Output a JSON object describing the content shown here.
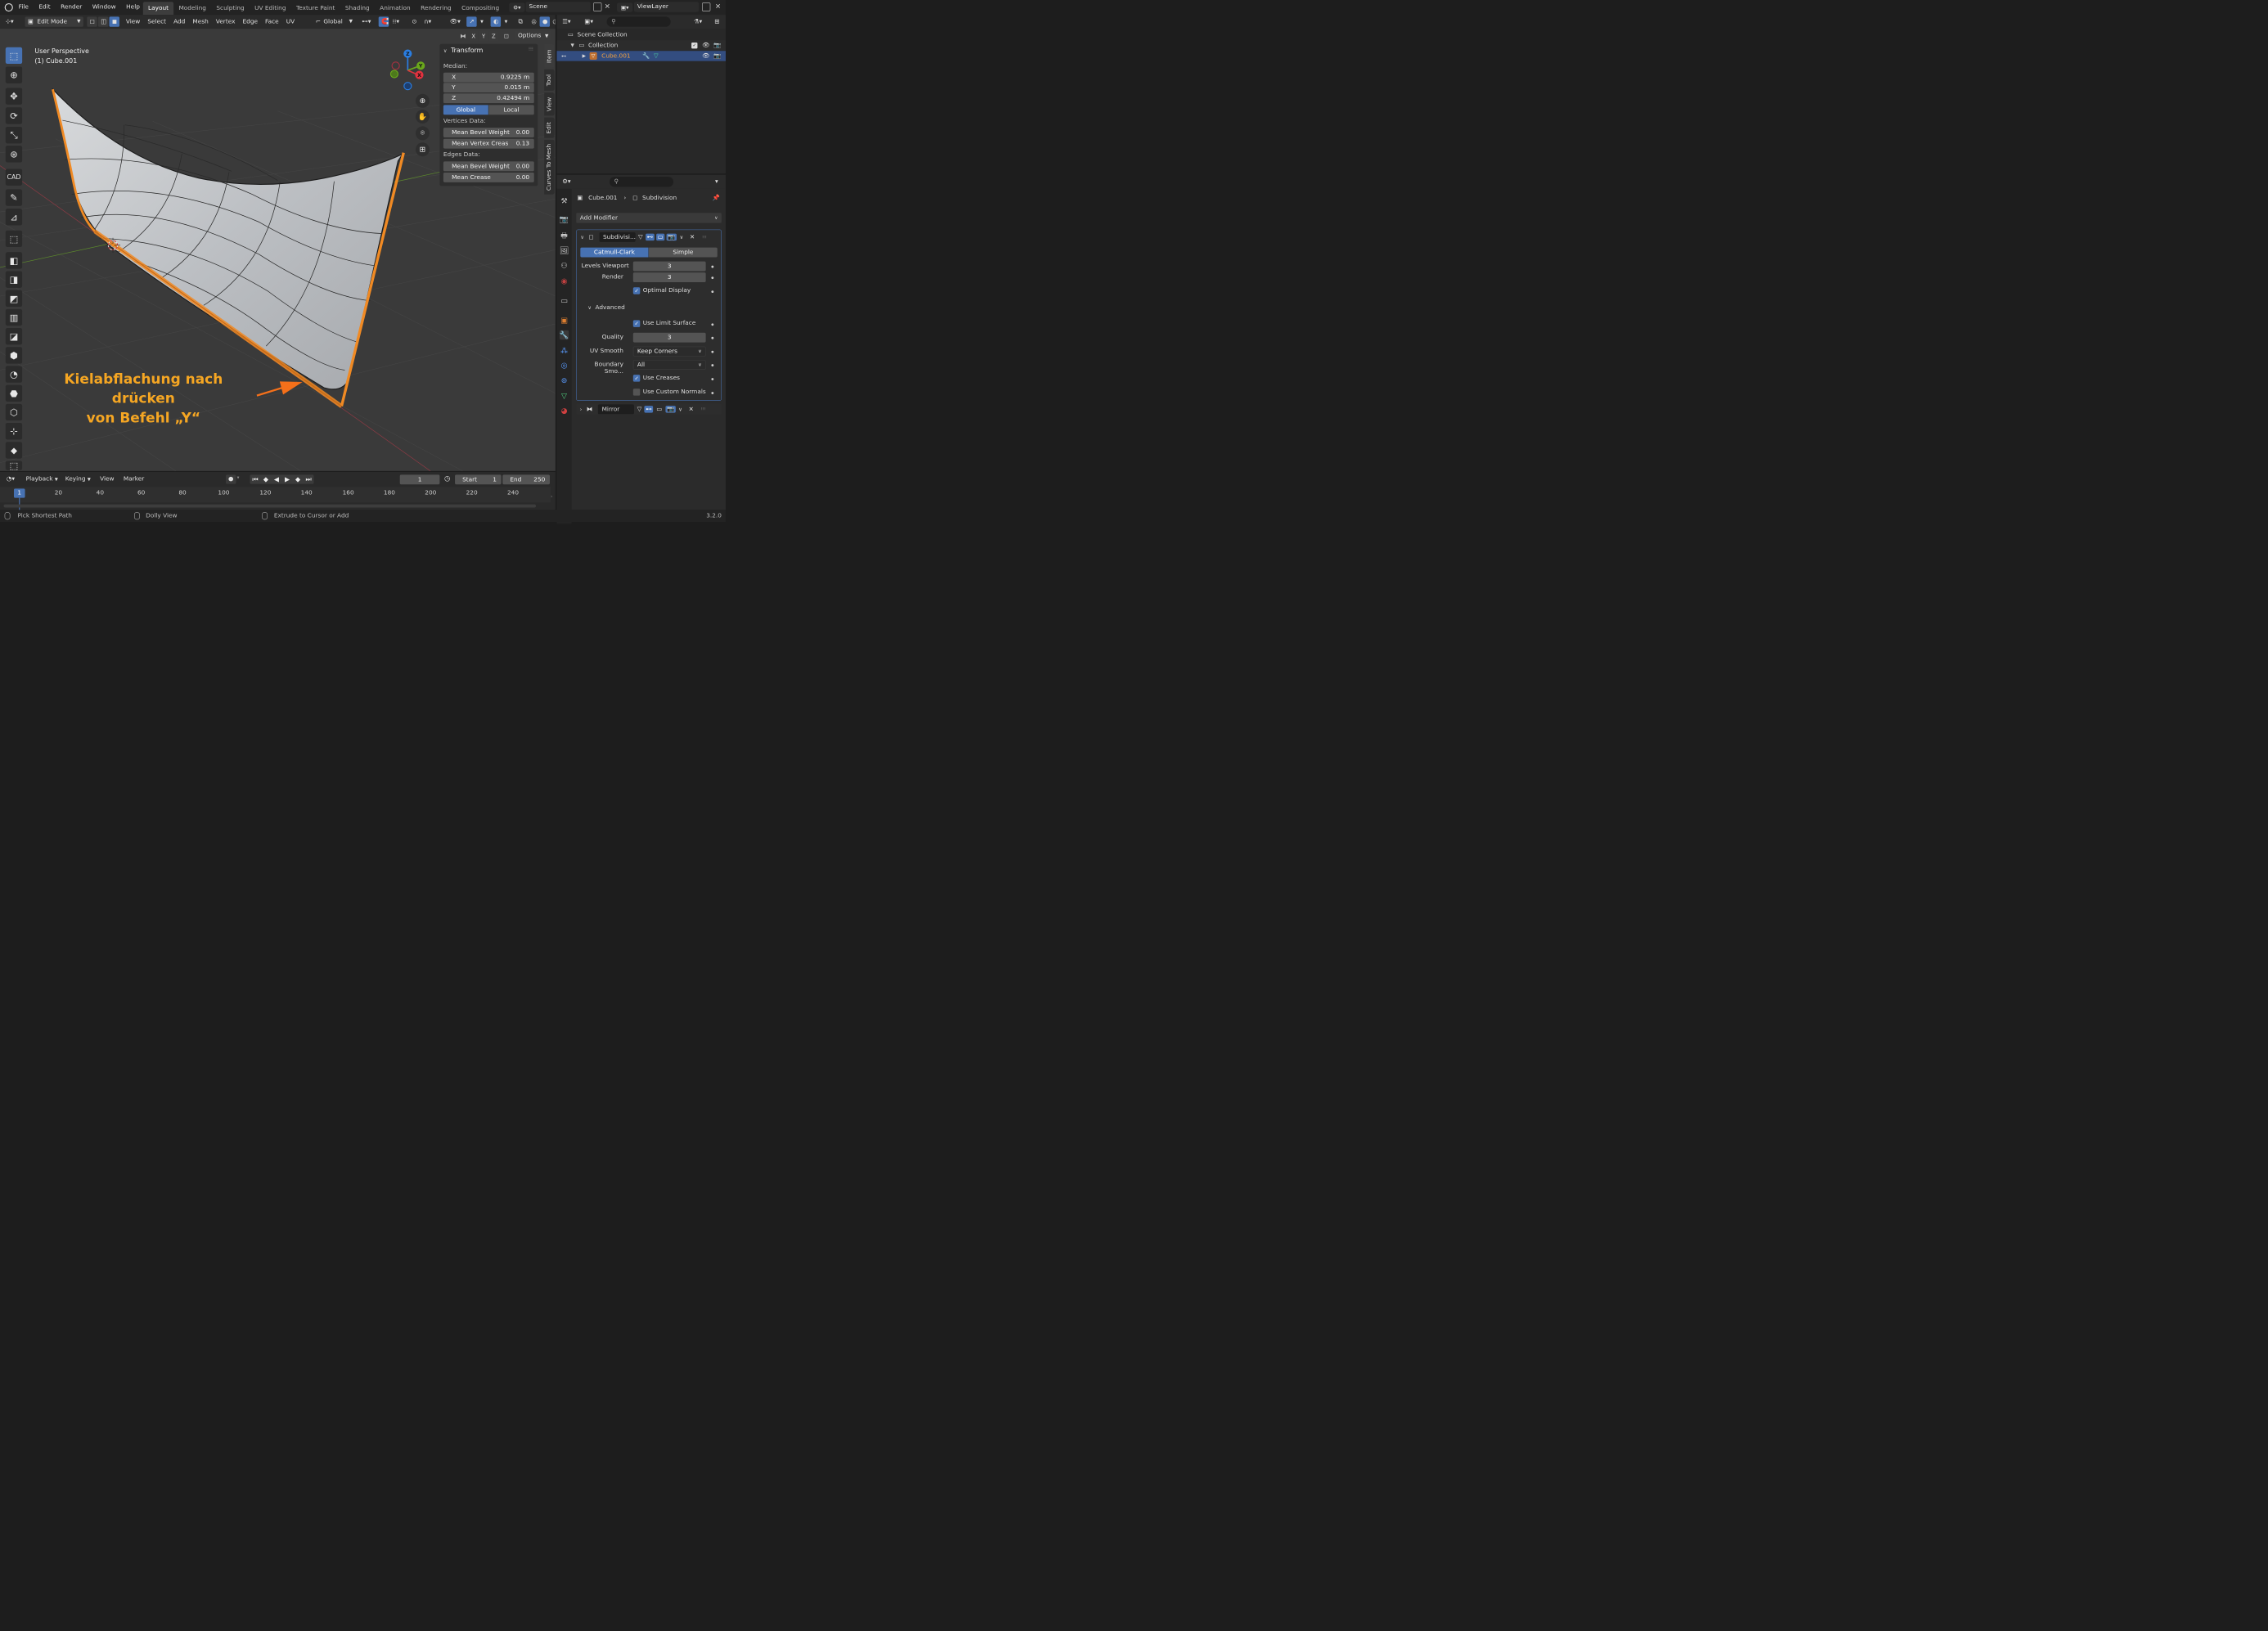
{
  "menubar": {
    "menus": [
      "File",
      "Edit",
      "Render",
      "Window",
      "Help"
    ],
    "workspaces": [
      "Layout",
      "Modeling",
      "Sculpting",
      "UV Editing",
      "Texture Paint",
      "Shading",
      "Animation",
      "Rendering",
      "Compositing"
    ],
    "active_workspace": "Layout",
    "scene": "Scene",
    "view_layer": "ViewLayer"
  },
  "header": {
    "mode": "Edit Mode",
    "menus": [
      "View",
      "Select",
      "Add",
      "Mesh",
      "Vertex",
      "Edge",
      "Face",
      "UV"
    ],
    "orientation": "Global",
    "axes": [
      "X",
      "Y",
      "Z"
    ],
    "options": "Options"
  },
  "viewport": {
    "perspective": "User Perspective",
    "object_label": "(1) Cube.001",
    "annotation_line1": "Kielabflachung nach drücken",
    "annotation_line2": "von Befehl „Y“",
    "annotation_color": "#f5a623",
    "gizmo_axes": [
      "Z",
      "Y",
      "X"
    ],
    "selection_color": "#f08a24"
  },
  "npanel": {
    "section": "Transform",
    "median_label": "Median:",
    "x_label": "X",
    "x_value": "0.9225 m",
    "y_label": "Y",
    "y_value": "0.015 m",
    "z_label": "Z",
    "z_value": "0.42494 m",
    "global": "Global",
    "local": "Local",
    "vertices_data": "Vertices Data:",
    "mean_bevel_weight_v_label": "Mean Bevel Weight",
    "mean_bevel_weight_v": "0.00",
    "mean_vertex_crease_label": "Mean Vertex Creas",
    "mean_vertex_crease": "0.13",
    "edges_data": "Edges Data:",
    "mean_bevel_weight_e_label": "Mean Bevel Weight",
    "mean_bevel_weight_e": "0.00",
    "mean_crease_label": "Mean Crease",
    "mean_crease": "0.00",
    "tabs": [
      "Item",
      "Tool",
      "View",
      "Edit",
      "Curves To Mesh"
    ]
  },
  "outliner": {
    "scene_collection": "Scene Collection",
    "collection": "Collection",
    "object": "Cube.001"
  },
  "properties": {
    "object": "Cube.001",
    "modifier_tab": "Subdivision",
    "add_modifier": "Add Modifier",
    "subdiv_name": "Subdivisi...",
    "catmull": "Catmull-Clark",
    "simple": "Simple",
    "levels_viewport_label": "Levels Viewport",
    "levels_viewport": "3",
    "render_label": "Render",
    "render": "3",
    "optimal_display": "Optimal Display",
    "advanced": "Advanced",
    "use_limit_surface": "Use Limit Surface",
    "quality_label": "Quality",
    "quality": "3",
    "uv_smooth_label": "UV Smooth",
    "uv_smooth": "Keep Corners",
    "boundary_label": "Boundary Smo...",
    "boundary": "All",
    "use_creases": "Use Creases",
    "use_custom_normals": "Use Custom Normals",
    "mirror_name": "Mirror"
  },
  "timeline": {
    "playback": "Playback",
    "keying": "Keying",
    "view": "View",
    "marker": "Marker",
    "current_frame": "1",
    "start_label": "Start",
    "start": "1",
    "end_label": "End",
    "end": "250",
    "ticks": [
      "1",
      "20",
      "40",
      "60",
      "80",
      "100",
      "120",
      "140",
      "160",
      "180",
      "200",
      "220",
      "240"
    ]
  },
  "statusbar": {
    "hint1": "Pick Shortest Path",
    "hint2": "Dolly View",
    "hint3": "Extrude to Cursor or Add",
    "version": "3.2.0"
  }
}
